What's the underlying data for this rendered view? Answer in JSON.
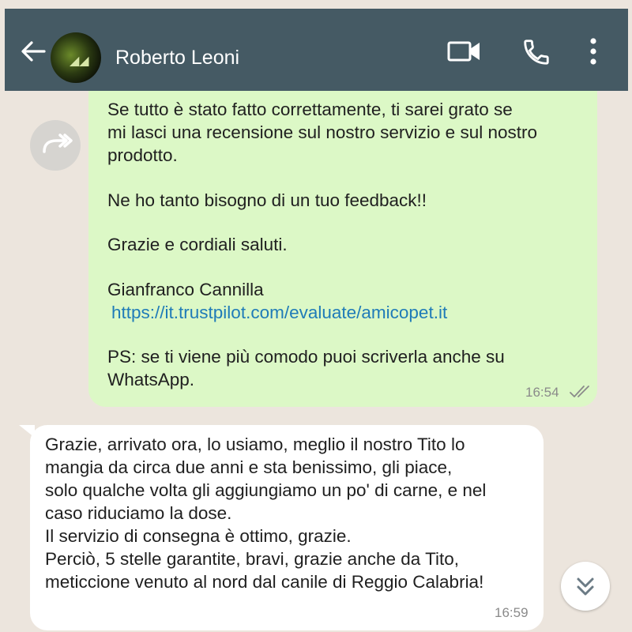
{
  "header": {
    "contact_name": "Roberto Leoni",
    "back_icon": "arrow-left-icon",
    "video_icon": "video-call-icon",
    "call_icon": "phone-icon",
    "menu_icon": "more-vert-icon",
    "bg_color": "#455a64"
  },
  "messages": {
    "outgoing": {
      "lines": [
        "Se tutto è stato fatto correttamente, ti sarei grato se",
        "mi lasci una recensione sul nostro servizio e sul nostro",
        "prodotto.",
        "",
        "Ne ho tanto bisogno di un tuo feedback!!",
        "",
        "Grazie e cordiali saluti.",
        "",
        "Gianfranco Cannilla"
      ],
      "link": "https://it.trustpilot.com/evaluate/amicopet.it",
      "ps_lines": [
        "PS: se ti viene più comodo puoi scriverla anche su",
        "WhatsApp."
      ],
      "time": "16:54",
      "status_icon": "double-check-icon",
      "forward_icon": "forward-icon",
      "bg_color": "#dcf8c6"
    },
    "incoming": {
      "lines": [
        "Grazie, arrivato ora, lo usiamo, meglio il nostro Tito lo",
        "mangia da circa due anni e sta benissimo, gli piace,",
        "solo qualche volta gli aggiungiamo un po' di carne, e nel",
        "caso riduciamo la dose.",
        "Il servizio di consegna è ottimo, grazie.",
        "Perciò, 5 stelle garantite, bravi, grazie anche da Tito,",
        "meticcione venuto al nord dal canile di Reggio Calabria!"
      ],
      "time": "16:59",
      "bg_color": "#ffffff"
    }
  },
  "scroll_icon": "double-chevron-down-icon",
  "chat_bg": "#ece5dd"
}
